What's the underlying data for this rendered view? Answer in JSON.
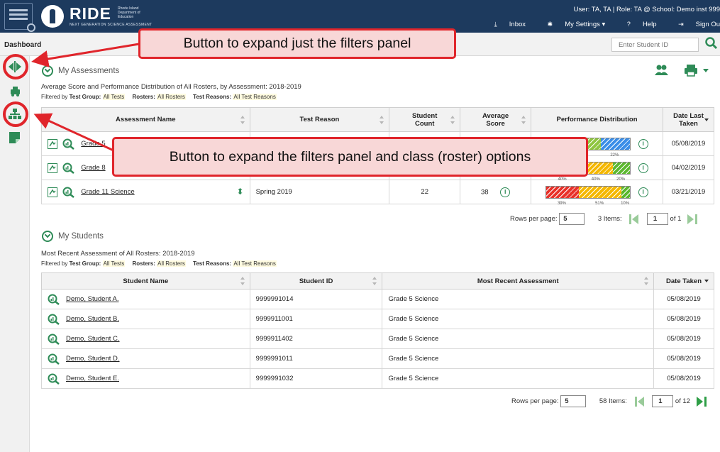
{
  "header": {
    "brand": "RIDE",
    "brand_sub": "Rhode Island Department of Education",
    "tagline": "NEXT GENERATION SCIENCE ASSESSMENT",
    "user_line": "User: TA, TA  |  Role: TA @ School: Demo inst 999",
    "nav": {
      "inbox": "Inbox",
      "settings": "My Settings",
      "help": "Help",
      "signout": "Sign Ou"
    }
  },
  "subheader": {
    "title": "Dashboard",
    "search_placeholder": "Enter Student ID"
  },
  "assessments": {
    "heading": "My Assessments",
    "subtitle": "Average Score and Performance Distribution of All Rosters, by Assessment: 2018-2019",
    "filter": {
      "filtered_by": "Filtered by",
      "test_group_label": "Test Group:",
      "test_group": "All Tests",
      "rosters_label": "Rosters:",
      "rosters": "All Rosters",
      "reasons_label": "Test Reasons:",
      "reasons": "All Test Reasons"
    },
    "columns": {
      "name": "Assessment Name",
      "reason": "Test Reason",
      "count": "Student Count",
      "score": "Average Score",
      "dist": "Performance Distribution",
      "date": "Date Last Taken"
    },
    "rows": [
      {
        "name": "Grade 5",
        "reason": "",
        "count": "",
        "score": "",
        "date": "05/08/2019",
        "dist": [
          {
            "pct": 0.35,
            "color": "#ffc000",
            "label": ""
          },
          {
            "pct": 0.3,
            "color": "#8fc63f",
            "label": ""
          },
          {
            "pct": 0.35,
            "color": "#3b8ee8",
            "label": "22%"
          }
        ]
      },
      {
        "name": "Grade 8",
        "reason": "",
        "count": "",
        "score": "",
        "date": "04/02/2019",
        "dist": [
          {
            "pct": 0.4,
            "color": "#e8322a",
            "label": "40%"
          },
          {
            "pct": 0.4,
            "color": "#f5b800",
            "label": "40%"
          },
          {
            "pct": 0.2,
            "color": "#5cb82f",
            "label": "20%"
          }
        ]
      },
      {
        "name": "Grade 11 Science",
        "reason": "Spring 2019",
        "count": "22",
        "score": "38",
        "date": "03/21/2019",
        "dist": [
          {
            "pct": 0.39,
            "color": "#e8322a",
            "label": "39%"
          },
          {
            "pct": 0.51,
            "color": "#f5b800",
            "label": "51%"
          },
          {
            "pct": 0.1,
            "color": "#5cb82f",
            "label": "10%"
          }
        ]
      }
    ],
    "pager": {
      "rows_label": "Rows per page:",
      "rows": "5",
      "items": "3 Items:",
      "page": "1",
      "of": "of 1"
    }
  },
  "students": {
    "heading": "My Students",
    "subtitle": "Most Recent Assessment of All Rosters: 2018-2019",
    "filter": {
      "filtered_by": "Filtered by",
      "test_group_label": "Test Group:",
      "test_group": "All Tests",
      "rosters_label": "Rosters:",
      "rosters": "All Rosters",
      "reasons_label": "Test Reasons:",
      "reasons": "All Test Reasons"
    },
    "columns": {
      "name": "Student Name",
      "id": "Student ID",
      "recent": "Most Recent Assessment",
      "date": "Date Taken"
    },
    "rows": [
      {
        "name": "Demo, Student A.",
        "id": "9999991014",
        "recent": "Grade 5 Science",
        "date": "05/08/2019"
      },
      {
        "name": "Demo, Student B.",
        "id": "9999911001",
        "recent": "Grade 5 Science",
        "date": "05/08/2019"
      },
      {
        "name": "Demo, Student C.",
        "id": "9999911402",
        "recent": "Grade 5 Science",
        "date": "05/08/2019"
      },
      {
        "name": "Demo, Student D.",
        "id": "9999991011",
        "recent": "Grade 5 Science",
        "date": "05/08/2019"
      },
      {
        "name": "Demo, Student E.",
        "id": "9999991032",
        "recent": "Grade 5 Science",
        "date": "05/08/2019"
      }
    ],
    "pager": {
      "rows_label": "Rows per page:",
      "rows": "5",
      "items": "58 Items:",
      "page": "1",
      "of": "of 12"
    }
  },
  "callouts": {
    "filters_only": "Button to expand just the filters panel",
    "filters_roster": "Button to expand the filters panel and class (roster) options"
  },
  "colors": {
    "header": "#1d3a5e",
    "accent": "#2e8b57",
    "callout_border": "#e0252b",
    "callout_bg": "#f8d7d7"
  }
}
